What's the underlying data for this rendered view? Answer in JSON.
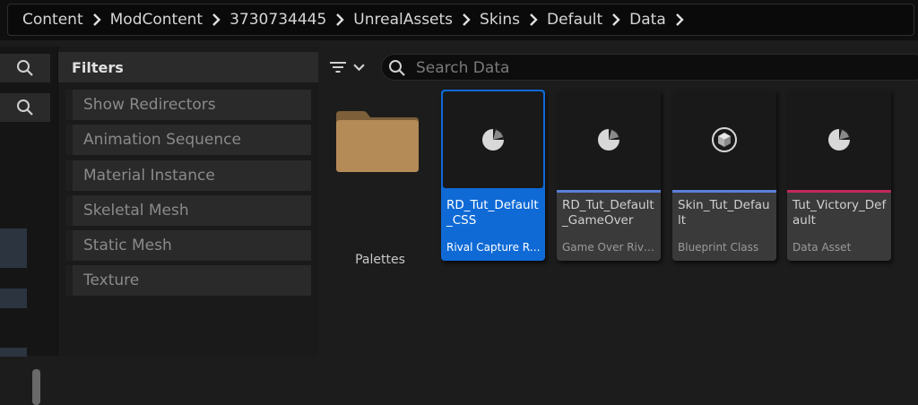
{
  "breadcrumb": {
    "items": [
      "Content",
      "ModContent",
      "3730734445",
      "UnrealAssets",
      "Skins",
      "Default",
      "Data"
    ]
  },
  "filters": {
    "title": "Filters",
    "items": [
      "Show Redirectors",
      "Animation Sequence",
      "Material Instance",
      "Skeletal Mesh",
      "Static Mesh",
      "Texture"
    ]
  },
  "search": {
    "placeholder": "Search Data",
    "value": ""
  },
  "folders": [
    {
      "label": "Palettes",
      "icon": "folder-icon"
    }
  ],
  "assets": [
    {
      "name": "RD_Tut_Default_CSS",
      "type": "Rival Capture Re...",
      "icon": "pie-icon",
      "accent": "#0f6ad6",
      "selected": true
    },
    {
      "name": "RD_Tut_Default_GameOver",
      "type": "Game Over Rival...",
      "icon": "pie-icon",
      "accent": "#5b7fd8",
      "selected": false
    },
    {
      "name": "Skin_Tut_Default",
      "type": "Blueprint Class",
      "icon": "cube-icon",
      "accent": "#5b7fd8",
      "selected": false
    },
    {
      "name": "Tut_Victory_Default",
      "type": "Data Asset",
      "icon": "pie-icon",
      "accent": "#c2285a",
      "selected": false
    }
  ],
  "colors": {
    "selection": "#0f6ad6",
    "data_asset": "#c2285a",
    "blueprint": "#5b7fd8"
  }
}
